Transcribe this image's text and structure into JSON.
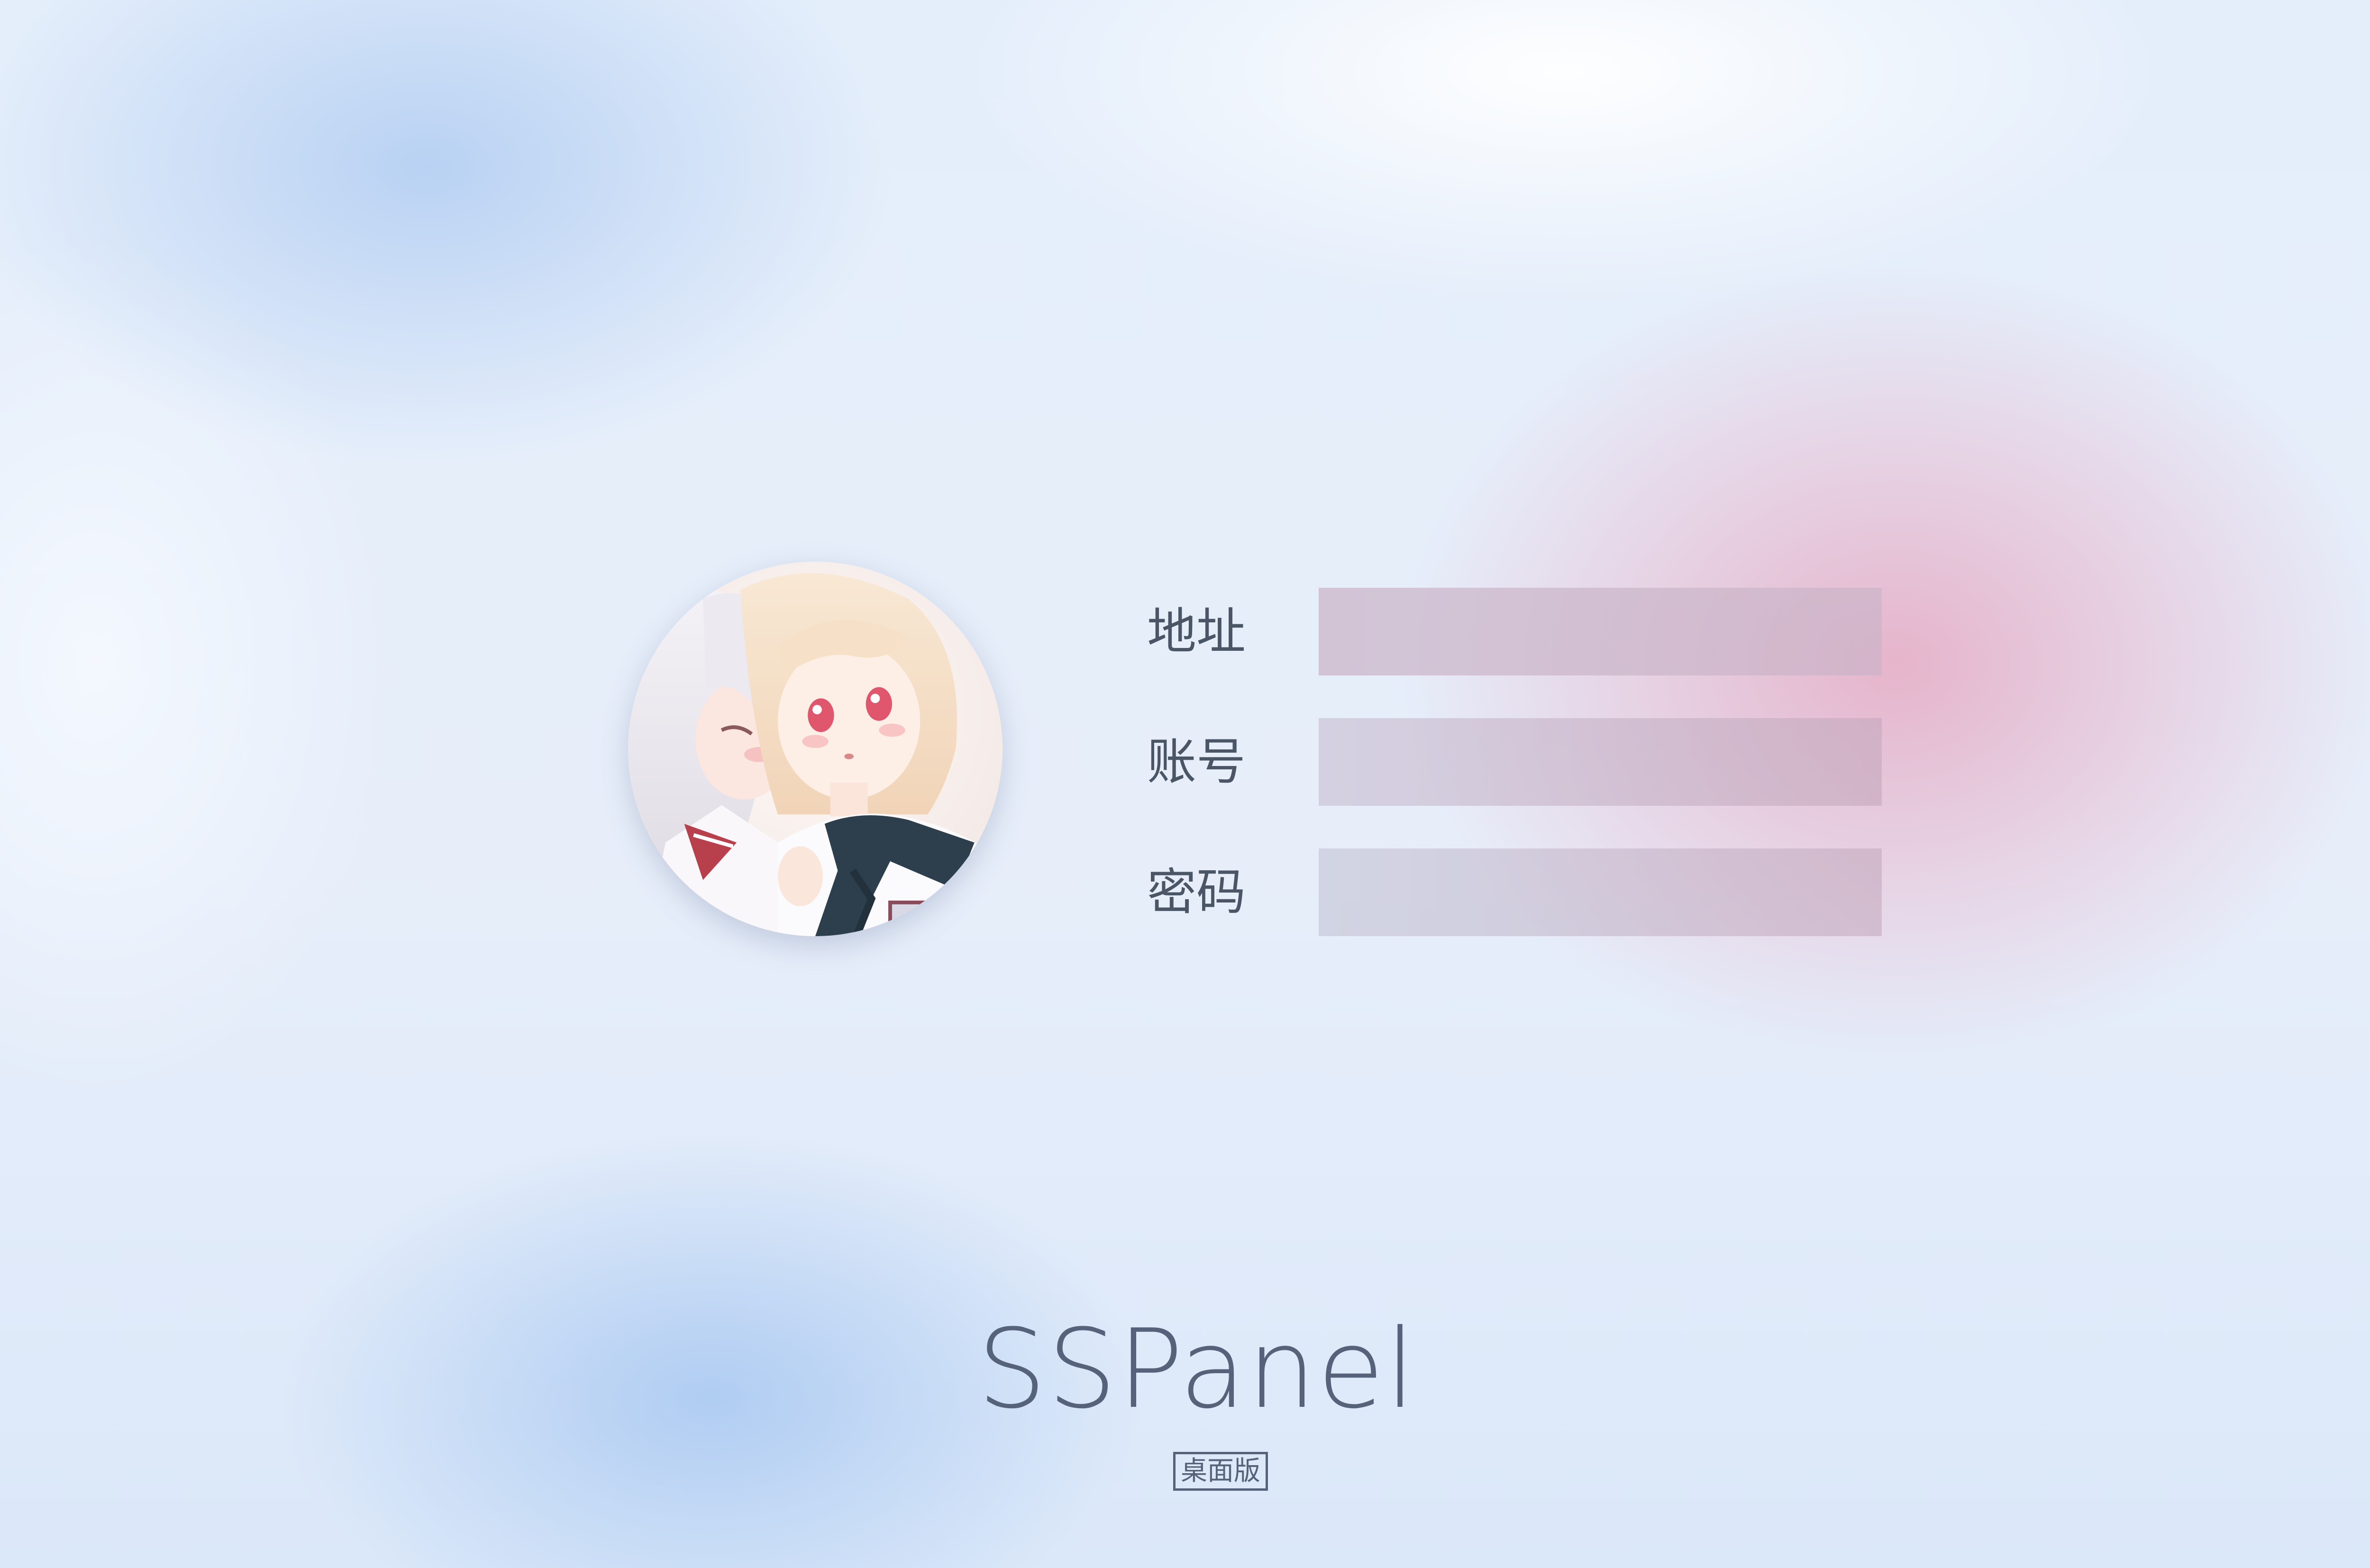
{
  "app": {
    "brand": "SSPanel",
    "edition": "桌面版"
  },
  "login_form": {
    "address_label": "地址",
    "address_value": "",
    "account_label": "账号",
    "account_value": "",
    "password_label": "密码",
    "password_value": ""
  },
  "avatar": {
    "image": "anime-girls-avatar"
  },
  "colors": {
    "text": "#4a5566",
    "brand_text": "#56627a",
    "input_tint": "#c8b4c6",
    "bg_blue": "#c6dbf6",
    "bg_pink": "#e8b6c8"
  }
}
